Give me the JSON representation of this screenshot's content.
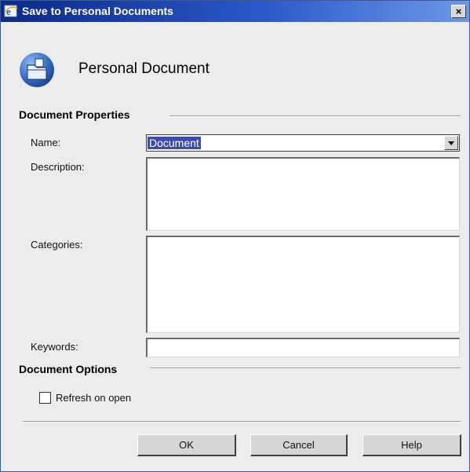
{
  "window": {
    "title": "Save to Personal Documents",
    "close_glyph": "×",
    "title_icon": "ie-icon"
  },
  "header": {
    "icon": "folder-icon",
    "title": "Personal Document"
  },
  "properties": {
    "section_title": "Document Properties",
    "name_label": "Name:",
    "name_value": "Document",
    "description_label": "Description:",
    "categories_label": "Categories:",
    "keywords_label": "Keywords:"
  },
  "options": {
    "section_title": "Document Options",
    "refresh_label": "Refresh on open",
    "refresh_checked": false
  },
  "buttons": {
    "ok": "OK",
    "cancel": "Cancel",
    "help": "Help"
  },
  "colors": {
    "title_bar": "#0a2a8c",
    "selection": "#3b4cb0",
    "dialog_bg": "#ececec"
  }
}
